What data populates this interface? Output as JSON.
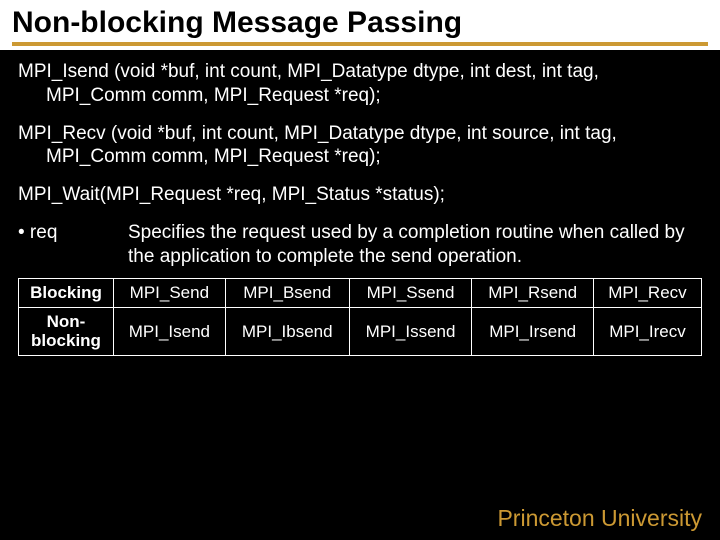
{
  "title": "Non-blocking Message Passing",
  "sig1": "MPI_Isend (void *buf, int count, MPI_Datatype dtype, int dest, int tag, MPI_Comm comm, MPI_Request *req);",
  "sig2": "MPI_Recv (void *buf, int count, MPI_Datatype dtype, int source, int tag, MPI_Comm comm, MPI_Request *req);",
  "sig3": "MPI_Wait(MPI_Request *req, MPI_Status *status);",
  "bullet": {
    "label": "• req",
    "desc": "Specifies the request used by a completion routine when called by the application to complete the send operation."
  },
  "table": {
    "rows": [
      {
        "head": "Blocking",
        "cells": [
          "MPI_Send",
          "MPI_Bsend",
          "MPI_Ssend",
          "MPI_Rsend",
          "MPI_Recv"
        ]
      },
      {
        "head": "Non-blocking",
        "cells": [
          "MPI_Isend",
          "MPI_Ibsend",
          "MPI_Issend",
          "MPI_Irsend",
          "MPI_Irecv"
        ]
      }
    ]
  },
  "footer": "Princeton University"
}
